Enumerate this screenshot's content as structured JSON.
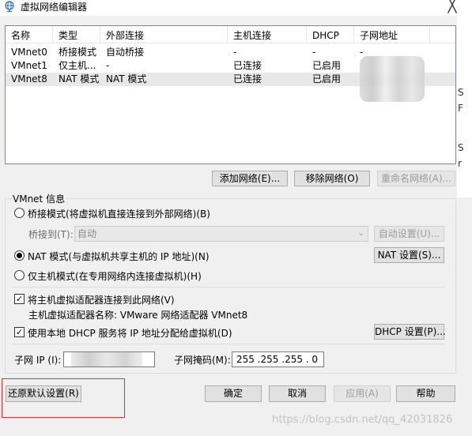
{
  "window": {
    "title": "虚拟网络编辑器",
    "close_glyph": "╳",
    "right_edge_text": [
      "S",
      "F",
      "S",
      "r"
    ]
  },
  "network_list": {
    "columns": [
      "名称",
      "类型",
      "外部连接",
      "主机连接",
      "DHCP",
      "子网地址"
    ],
    "rows": [
      {
        "name": "VMnet0",
        "type": "桥接模式",
        "external": "自动桥接",
        "host": "-",
        "dhcp": "-",
        "subnet": "-",
        "selected": false
      },
      {
        "name": "VMnet1",
        "type": "仅主机...",
        "external": "-",
        "host": "已连接",
        "dhcp": "已启用",
        "subnet": "",
        "selected": false
      },
      {
        "name": "VMnet8",
        "type": "NAT 模式",
        "external": "NAT 模式",
        "host": "已连接",
        "dhcp": "已启用",
        "subnet": "",
        "selected": true
      }
    ]
  },
  "list_buttons": {
    "add": "添加网络(E)...",
    "remove": "移除网络(O)",
    "rename": "重命名网络(A)..."
  },
  "vmnet_info": {
    "legend": "VMnet 信息",
    "bridged_label": "桥接模式(将虚拟机直接连接到外部网络)(B)",
    "bridged_to_label": "桥接到(T):",
    "bridged_to_value": "自动",
    "auto_settings": "自动设置(U)...",
    "nat_label": "NAT 模式(与虚拟机共享主机的 IP 地址)(N)",
    "nat_settings": "NAT 设置(S)...",
    "hostonly_label": "仅主机模式(在专用网络内连接虚拟机)(H)",
    "connect_adapter_label": "将主机虚拟适配器连接到此网络(V)",
    "adapter_name_label": "主机虚拟适配器名称: VMware 网络适配器 VMnet8",
    "dhcp_label": "使用本地 DHCP 服务将 IP 地址分配给虚拟机(D)",
    "dhcp_settings": "DHCP 设置(P)...",
    "subnet_ip_label": "子网 IP (I):",
    "subnet_ip_value": "",
    "subnet_mask_label": "子网掩码(M):",
    "subnet_mask_value": "255 .255 .255 . 0",
    "selected_mode": "nat",
    "connect_adapter_checked": true,
    "dhcp_checked": true
  },
  "footer": {
    "restore_defaults": "还原默认设置(R)",
    "ok": "确定",
    "cancel": "取消",
    "apply": "应用(A)",
    "help": "帮助"
  },
  "watermark": "https://blog.csdn.net/qq_42031826",
  "colors": {
    "highlight_box": "#e03131",
    "window_bg": "#f0f0f0",
    "selected_row": "#e8e8e8"
  }
}
